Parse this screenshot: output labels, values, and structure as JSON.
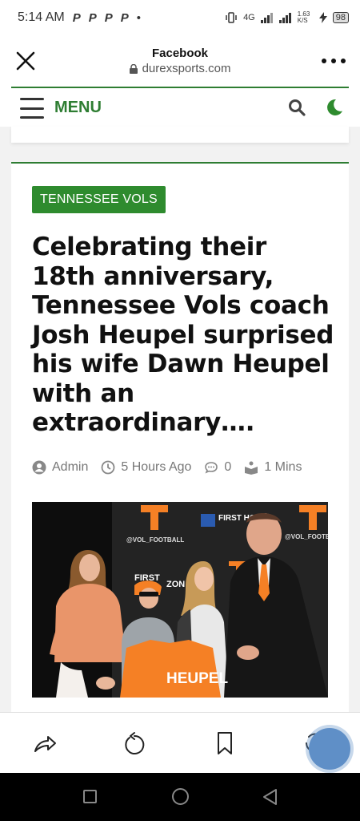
{
  "status_bar": {
    "time": "5:14 AM",
    "notif_icons": [
      "P",
      "P",
      "P",
      "P"
    ],
    "dot": "•",
    "network": "4G",
    "speed": "1.63 K/S",
    "battery": "98"
  },
  "browser": {
    "title": "Facebook",
    "url": "durexsports.com"
  },
  "nav": {
    "menu_label": "MENU"
  },
  "article": {
    "category": "TENNESSEE VOLS",
    "headline": "Celebrating their 18th anniversary, Tennessee Vols coach Josh Heupel surprised his wife Dawn Heupel with an extraordinary….",
    "author": "Admin",
    "time_ago": "5 Hours Ago",
    "comments": "0",
    "read_time": "1 Mins",
    "image": {
      "background_texts": [
        "@VOL_FOOTBALL",
        "FIRST HORI",
        "FIRST",
        "ZON",
        "@VOL_FOOTB"
      ],
      "jersey_text": "HEUPEL"
    }
  },
  "colors": {
    "accent": "#2e7d32",
    "badge": "#2e8b2e",
    "vols_orange": "#f58025"
  }
}
